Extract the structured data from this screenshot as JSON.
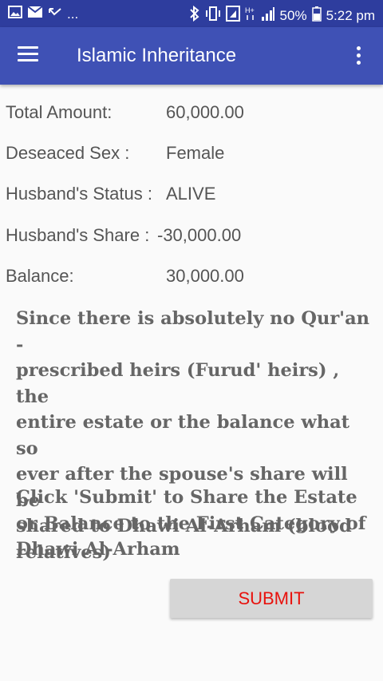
{
  "status_bar": {
    "left_overflow": "...",
    "battery": "50%",
    "time": "5:22 pm"
  },
  "app_bar": {
    "title": "Islamic Inheritance"
  },
  "details": {
    "total_amount": {
      "label": "Total Amount:",
      "value": "60,000.00"
    },
    "deceased_sex": {
      "label": "Deseaced Sex :",
      "value": "Female"
    },
    "husband_status": {
      "label": "Husband's Status :",
      "value": "ALIVE"
    },
    "husband_share": {
      "label": "Husband's Share :",
      "value": "-30,000.00"
    },
    "balance": {
      "label": "Balance:",
      "value": "30,000.00"
    }
  },
  "message": {
    "explanation": "Since there is absolutely no Qur'an -\nprescribed heirs (Furud' heirs) , the\nentire estate or the balance what so\never after the spouse's share  will be\nshared to Dhawi Al-Arham (blood\nrelatives)",
    "instruction": "Click 'Submit' to Share the Estate\nor Balance to the First Category of\nDhawi Al-Arham"
  },
  "submit_button": {
    "label": "SUBMIT"
  },
  "colors": {
    "status_bar": "#2e3d9e",
    "app_bar": "#3f51b5",
    "submit_text": "#e8120d",
    "submit_bg": "#d6d6d6"
  }
}
